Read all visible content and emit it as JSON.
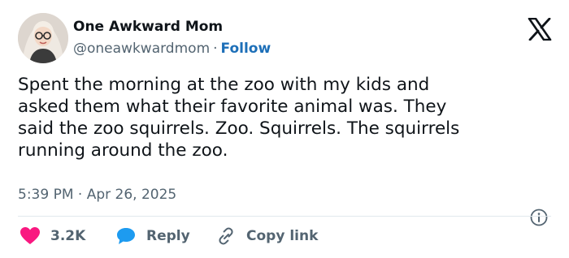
{
  "author": {
    "name": "One Awkward Mom",
    "handle": "@oneawkwardmom",
    "separator": "·",
    "follow_label": "Follow"
  },
  "tweet": {
    "text": "Spent the morning at the zoo with my kids and\nasked them what their favorite animal was. They\nsaid the zoo squirrels. Zoo. Squirrels. The squirrels\nrunning around the zoo."
  },
  "meta": {
    "time": "5:39 PM",
    "separator": "·",
    "date": "Apr 26, 2025"
  },
  "actions": {
    "likes_count": "3.2K",
    "reply_label": "Reply",
    "copy_link_label": "Copy link"
  },
  "icons": {
    "logo": "x-logo-icon",
    "info": "info-icon",
    "like": "heart-icon",
    "reply": "speech-bubble-icon",
    "copy": "link-icon"
  },
  "colors": {
    "text": "#0f1419",
    "secondary": "#536471",
    "follow": "#1d6fb8",
    "heart": "#f91880",
    "reply_bubble": "#1d9bf0"
  }
}
